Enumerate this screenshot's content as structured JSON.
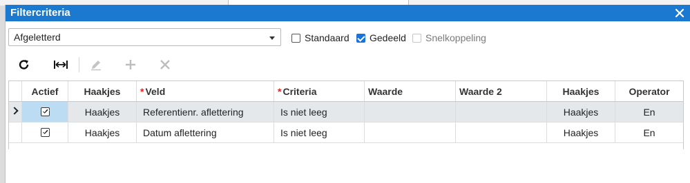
{
  "dialog": {
    "title": "Filtercriteria",
    "close_icon": "close-icon"
  },
  "filter": {
    "selected": "Afgeletterd",
    "checkboxes": [
      {
        "label": "Standaard",
        "checked": false,
        "disabled": false
      },
      {
        "label": "Gedeeld",
        "checked": true,
        "disabled": false
      },
      {
        "label": "Snelkoppeling",
        "checked": false,
        "disabled": true
      }
    ]
  },
  "toolbar": {
    "buttons": [
      {
        "icon": "refresh-icon",
        "enabled": true
      },
      {
        "icon": "fit-columns-icon",
        "enabled": true
      },
      {
        "icon": "edit-icon",
        "enabled": false
      },
      {
        "icon": "add-icon",
        "enabled": false
      },
      {
        "icon": "delete-icon",
        "enabled": false
      }
    ]
  },
  "grid": {
    "columns": [
      {
        "label": "Actief",
        "required": false
      },
      {
        "label": "Haakjes",
        "required": false
      },
      {
        "label": "Veld",
        "required": true
      },
      {
        "label": "Criteria",
        "required": true
      },
      {
        "label": "Waarde",
        "required": false
      },
      {
        "label": "Waarde 2",
        "required": false
      },
      {
        "label": "Haakjes",
        "required": false
      },
      {
        "label": "Operator",
        "required": false
      }
    ],
    "rows": [
      {
        "selected": true,
        "actief": true,
        "haakjes_open": "Haakjes",
        "veld": "Referentienr. aflettering",
        "criteria": "Is niet leeg",
        "waarde": "",
        "waarde2": "",
        "haakjes_close": "Haakjes",
        "operator": "En"
      },
      {
        "selected": false,
        "actief": true,
        "haakjes_open": "Haakjes",
        "veld": "Datum aflettering",
        "criteria": "Is niet leeg",
        "waarde": "",
        "waarde2": "",
        "haakjes_close": "Haakjes",
        "operator": "En"
      }
    ]
  },
  "colors": {
    "titlebar": "#1b79d0",
    "checkbox_checked": "#1a73d9",
    "selected_row": "#e5e8ea",
    "active_cell": "#bcdcf3",
    "required_marker": "#e02020"
  }
}
